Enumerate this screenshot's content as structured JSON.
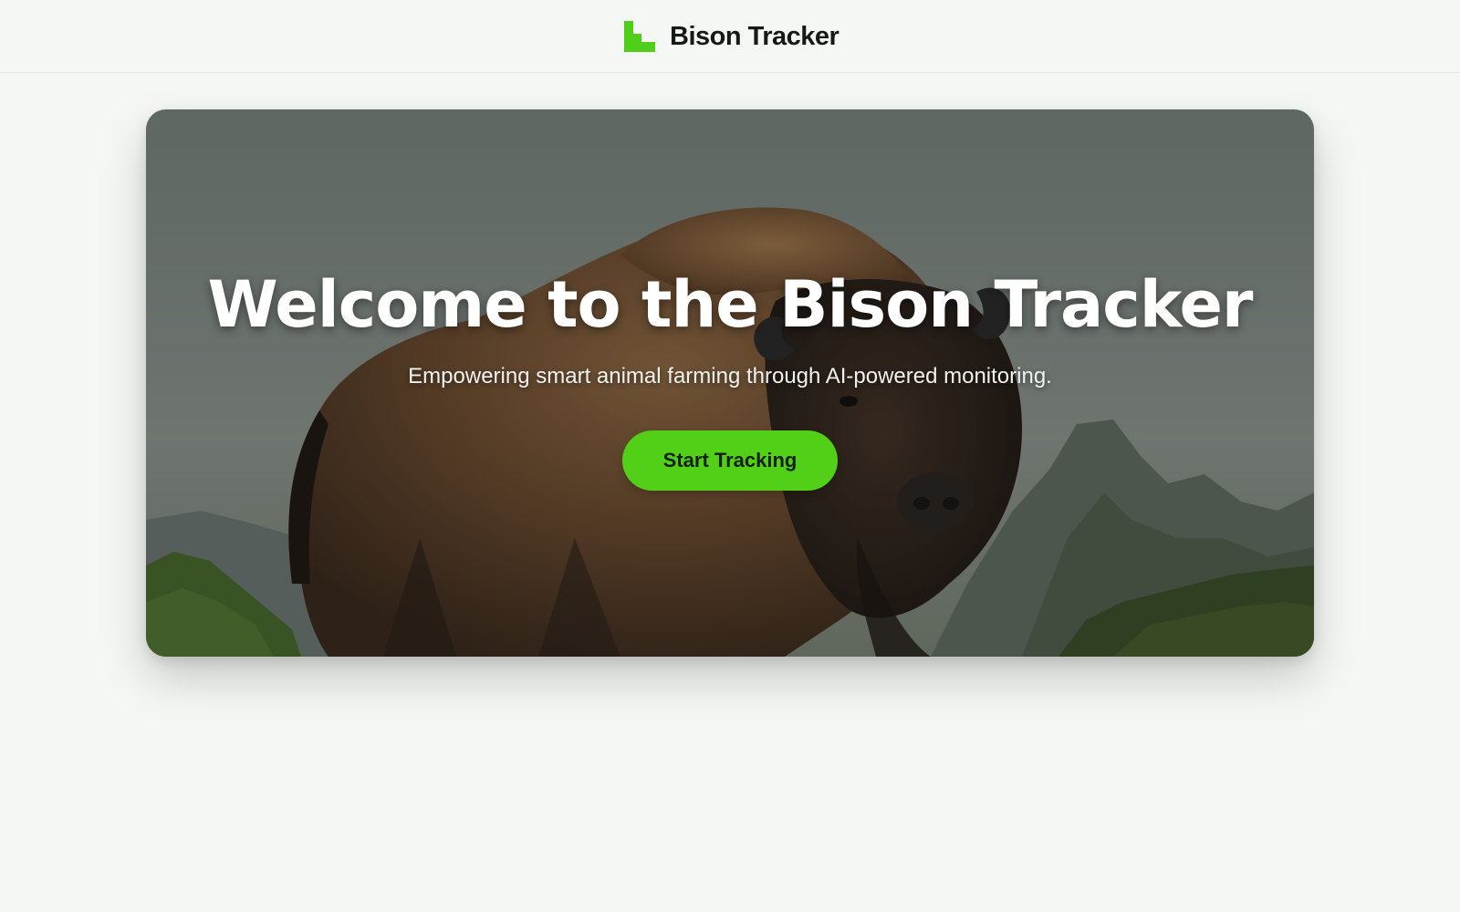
{
  "brand": {
    "name": "Bison Tracker",
    "icon": "stair-block-logo-icon",
    "accent_color": "#4fcf1a"
  },
  "hero": {
    "title": "Welcome to the Bison Tracker",
    "subtitle": "Empowering smart animal farming through AI-powered monitoring.",
    "cta_label": "Start Tracking",
    "cta_color": "#52d018",
    "background_image": "bison-on-mountain-photo"
  }
}
